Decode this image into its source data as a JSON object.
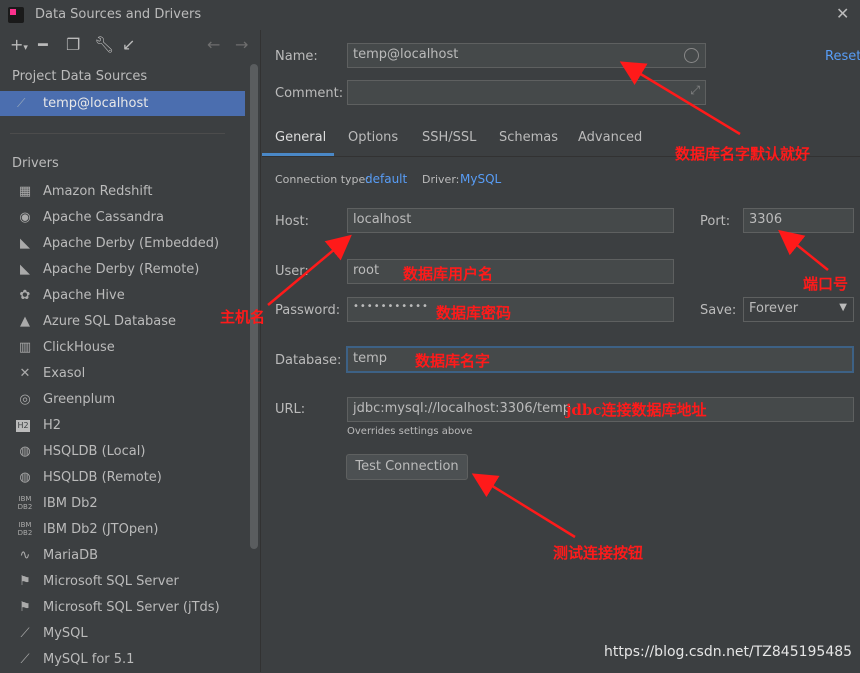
{
  "window": {
    "title": "Data Sources and Drivers"
  },
  "sidebar": {
    "project_header": "Project Data Sources",
    "selected_source": "temp@localhost",
    "drivers_header": "Drivers",
    "drivers": [
      "Amazon Redshift",
      "Apache Cassandra",
      "Apache Derby (Embedded)",
      "Apache Derby (Remote)",
      "Apache Hive",
      "Azure SQL Database",
      "ClickHouse",
      "Exasol",
      "Greenplum",
      "H2",
      "HSQLDB (Local)",
      "HSQLDB (Remote)",
      "IBM Db2",
      "IBM Db2 (JTOpen)",
      "MariaDB",
      "Microsoft SQL Server",
      "Microsoft SQL Server (jTds)",
      "MySQL",
      "MySQL for 5.1"
    ]
  },
  "form": {
    "name_label": "Name:",
    "name_value": "temp@localhost",
    "comment_label": "Comment:",
    "comment_value": "",
    "reset_label": "Reset",
    "tabs": [
      "General",
      "Options",
      "SSH/SSL",
      "Schemas",
      "Advanced"
    ],
    "connection_type_label": "Connection type:",
    "connection_type_value": "default",
    "driver_label": "Driver:",
    "driver_value": "MySQL",
    "host_label": "Host:",
    "host_value": "localhost",
    "port_label": "Port:",
    "port_value": "3306",
    "user_label": "User:",
    "user_value": "root",
    "password_label": "Password:",
    "password_value": "•••••••••••",
    "save_label": "Save:",
    "save_value": "Forever",
    "database_label": "Database:",
    "database_value": "temp",
    "url_label": "URL:",
    "url_value": "jdbc:mysql://localhost:3306/temp",
    "url_hint": "Overrides settings above",
    "test_button": "Test Connection"
  },
  "annotations": {
    "db_name_default": "数据库名字默认就好",
    "port": "端口号",
    "host": "主机名",
    "user": "数据库用户名",
    "password": "数据库密码",
    "database": "数据库名字",
    "url": "jdbc连接数据库地址",
    "test": "测试连接按钮"
  },
  "watermark": "https://blog.csdn.net/TZ845195485",
  "colors": {
    "accent": "#4a88c7",
    "selection": "#4b6eaf",
    "annotation": "#ff1a1a",
    "link": "#589df6"
  }
}
